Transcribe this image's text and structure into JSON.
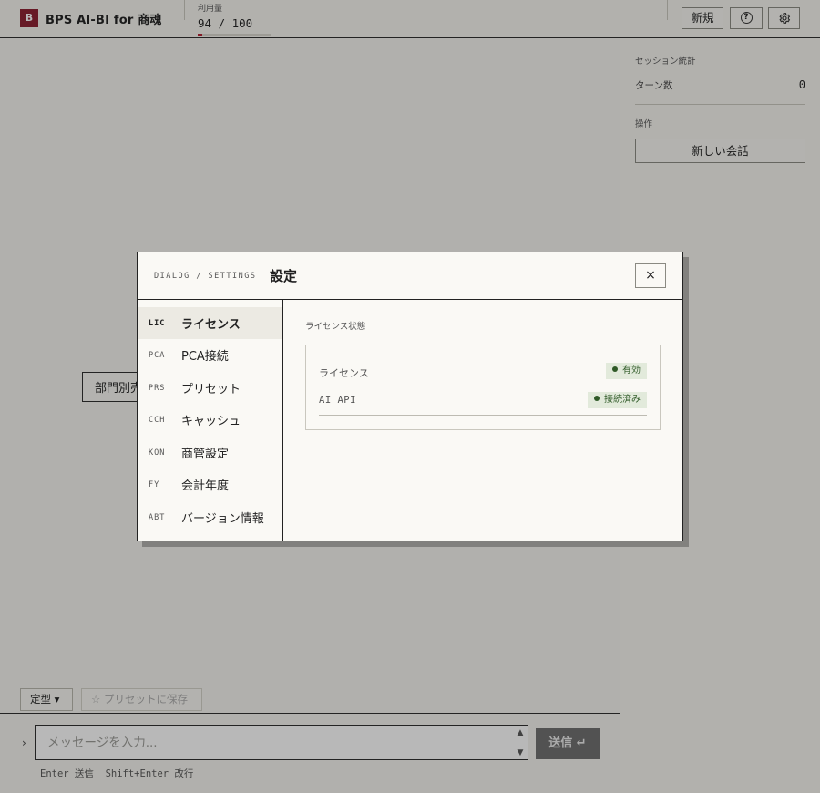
{
  "header": {
    "logo_letter": "B",
    "app_title": "BPS AI-BI for 商魂",
    "usage_label": "利用量",
    "usage_value": "94 / 100",
    "usage_fraction": 0.06,
    "new_label": "新規",
    "help_icon": "help-circle-icon",
    "settings_icon": "gear-icon"
  },
  "right_panel": {
    "stats_label": "セッション統計",
    "turns_label": "ターン数",
    "turns_value": "0",
    "ops_label": "操作",
    "new_conversation": "新しい会話"
  },
  "background": {
    "chip_partial": "部門別売"
  },
  "composer": {
    "template_button": "定型 ▾",
    "save_preset_button": "☆ プリセットに保存",
    "prompt_caret": "›",
    "input_placeholder": "メッセージを入力...",
    "send_label": "送信 ↵",
    "hint": "Enter 送信  Shift+Enter 改行"
  },
  "dialog": {
    "breadcrumb": "DIALOG / SETTINGS",
    "title": "設定",
    "close": "×",
    "nav": [
      {
        "code": "LIC",
        "label": "ライセンス",
        "active": true
      },
      {
        "code": "PCA",
        "label": "PCA接続"
      },
      {
        "code": "PRS",
        "label": "プリセット"
      },
      {
        "code": "CCH",
        "label": "キャッシュ"
      },
      {
        "code": "KON",
        "label": "商管設定"
      },
      {
        "code": "FY",
        "label": "会計年度"
      },
      {
        "code": "ABT",
        "label": "バージョン情報"
      }
    ],
    "section_label": "ライセンス状態",
    "status": [
      {
        "name": "ライセンス",
        "badge": "有効"
      },
      {
        "name": "AI API",
        "badge": "接続済み"
      }
    ]
  },
  "colors": {
    "brand": "#8b1e2e",
    "usage_fill": "#b31d2e",
    "badge_bg": "#e2eadb",
    "badge_text": "#2f5a27",
    "send_bg": "#6e6e6e"
  }
}
